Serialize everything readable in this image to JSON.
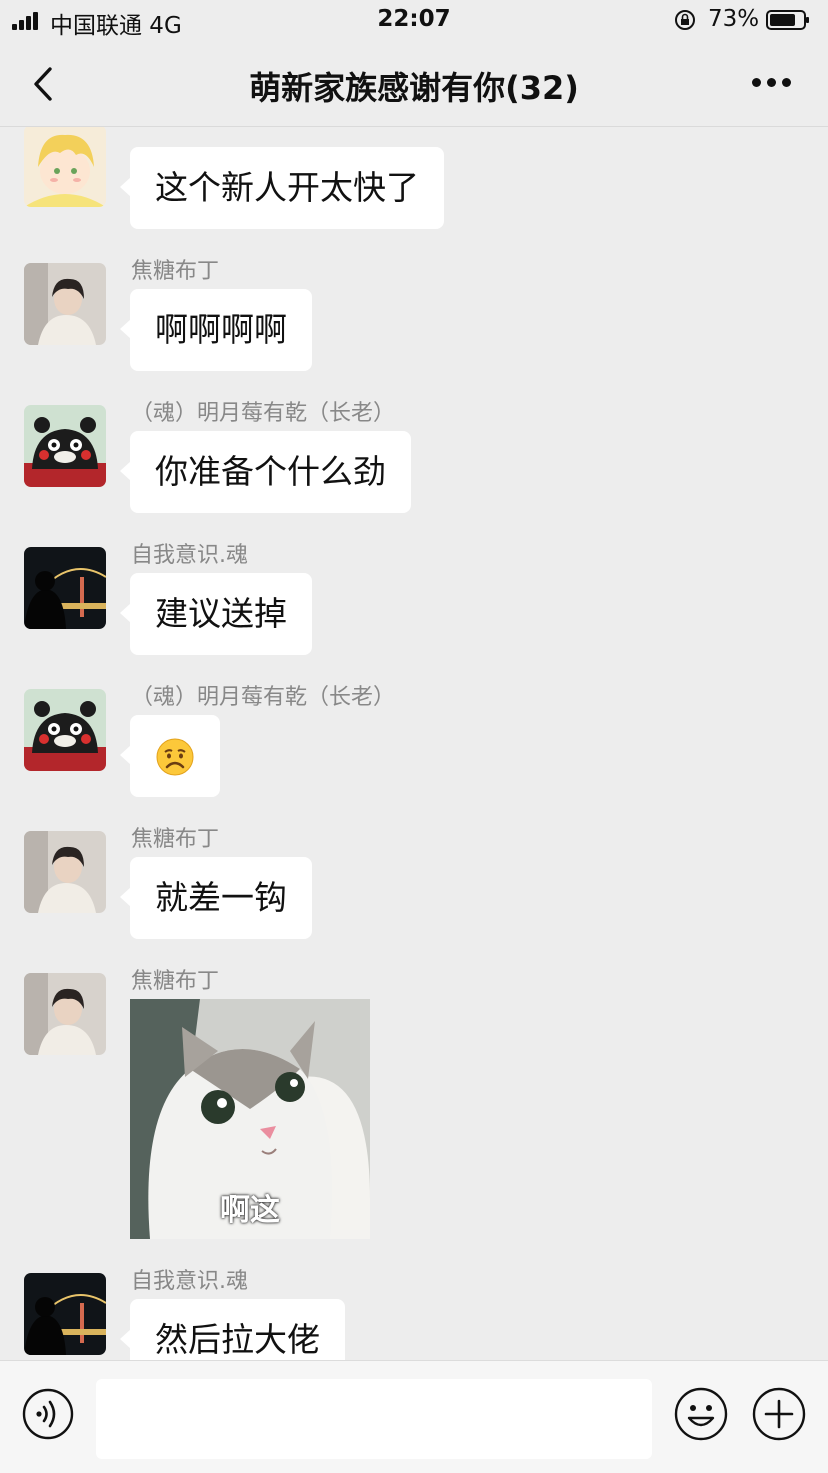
{
  "status_bar": {
    "carrier": "中国联通   4G",
    "time": "22:07",
    "battery": "73%"
  },
  "header": {
    "title": "萌新家族感谢有你(32)"
  },
  "messages": [
    {
      "sender": "",
      "text": "这个新人开太快了"
    },
    {
      "sender": "焦糖布丁",
      "text": "啊啊啊啊"
    },
    {
      "sender": "（魂）明月莓有乾（长老）",
      "text": "你准备个什么劲"
    },
    {
      "sender": "自我意识.魂",
      "text": "建议送掉"
    },
    {
      "sender": "（魂）明月莓有乾（长老）",
      "text": ""
    },
    {
      "sender": "焦糖布丁",
      "text": "就差一钩"
    },
    {
      "sender": "焦糖布丁",
      "sticker_caption": "啊这"
    },
    {
      "sender": "自我意识.魂",
      "text": "然后拉大佬"
    }
  ],
  "input": {
    "value": ""
  },
  "icons": {
    "back": "chevron-left-icon",
    "more": "more-icon",
    "voice": "voice-icon",
    "emoji": "emoji-icon",
    "plus": "plus-icon"
  }
}
